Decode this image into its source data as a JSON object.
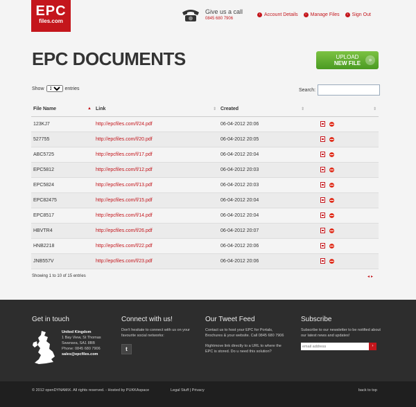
{
  "header": {
    "logo_line1": "EPC",
    "logo_line2": "files.com",
    "give_us_call": "Give us a call",
    "phone": "0845 680 7906",
    "nav": [
      "Account Details",
      "Manage Files",
      "Sign Out"
    ]
  },
  "page": {
    "title": "EPC DOCUMENTS",
    "upload_line1": "UPLOAD",
    "upload_line2": "NEW FILE"
  },
  "controls": {
    "show_label": "Show",
    "entries_value": "10",
    "entries_label": "entries",
    "search_label": "Search:"
  },
  "table": {
    "headers": [
      "File Name",
      "Link",
      "Created"
    ],
    "rows": [
      {
        "name": "123KJ7",
        "link": "http://epcfiles.com/f/24.pdf",
        "created": "06-04-2012 20:06"
      },
      {
        "name": "527755",
        "link": "http://epcfiles.com/f/20.pdf",
        "created": "06-04-2012 20:05"
      },
      {
        "name": "ABC5725",
        "link": "http://epcfiles.com/f/17.pdf",
        "created": "06-04-2012 20:04"
      },
      {
        "name": "EPC5812",
        "link": "http://epcfiles.com/f/12.pdf",
        "created": "06-04-2012 20:03"
      },
      {
        "name": "EPC5824",
        "link": "http://epcfiles.com/f/13.pdf",
        "created": "06-04-2012 20:03"
      },
      {
        "name": "EPC82475",
        "link": "http://epcfiles.com/f/15.pdf",
        "created": "06-04-2012 20:04"
      },
      {
        "name": "EPC8517",
        "link": "http://epcfiles.com/f/14.pdf",
        "created": "06-04-2012 20:04"
      },
      {
        "name": "HBVTR4",
        "link": "http://epcfiles.com/f/26.pdf",
        "created": "06-04-2012 20:07"
      },
      {
        "name": "HNB2218",
        "link": "http://epcfiles.com/f/22.pdf",
        "created": "06-04-2012 20:06"
      },
      {
        "name": "JNB557V",
        "link": "http://epcfiles.com/f/23.pdf",
        "created": "06-04-2012 20:06"
      }
    ],
    "showing": "Showing 1 to 10 of 15 entries"
  },
  "footer": {
    "git_title": "Get in touch",
    "addr_name": "United Kingdom",
    "addr_line1": "1 Bay View, St Thomas",
    "addr_line2": "Swansea, SA1 8BB",
    "addr_phone": "Phone: 0845 680 7906",
    "addr_email": "sales@epcfiles.com",
    "connect_title": "Connect with us!",
    "connect_text": "Don't hesitate to connect with us on your favourite social networks:",
    "tweet_title": "Our Tweet Feed",
    "tweet1": "Contact us to host your EPC for Portals, Brochures & your website. Call 0845 680 7906",
    "tweet2": "Rightmove link directly to a URL to where the EPC is stored. Do u need this solution?",
    "sub_title": "Subscribe",
    "sub_text": "Subscribe to our newsletter to be notified about our latest news and updates!",
    "email_placeholder": "email address"
  },
  "bottom": {
    "copyright": "© 2012 openDYNAMiX. All rights reserved. - Hosted by PUKKAspace",
    "legal": "Legal Stuff | Privacy",
    "back_to_top": "back to top"
  },
  "colors": {
    "brand": "#c4161c",
    "upload": "#5aac2c",
    "footer": "#2d2d2d"
  }
}
